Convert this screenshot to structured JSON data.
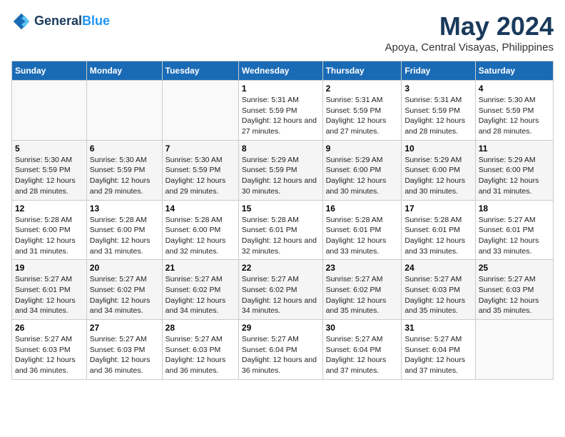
{
  "logo": {
    "line1": "General",
    "line2": "Blue"
  },
  "title": "May 2024",
  "subtitle": "Apoya, Central Visayas, Philippines",
  "days_of_week": [
    "Sunday",
    "Monday",
    "Tuesday",
    "Wednesday",
    "Thursday",
    "Friday",
    "Saturday"
  ],
  "weeks": [
    [
      {
        "day": "",
        "info": ""
      },
      {
        "day": "",
        "info": ""
      },
      {
        "day": "",
        "info": ""
      },
      {
        "day": "1",
        "info": "Sunrise: 5:31 AM\nSunset: 5:59 PM\nDaylight: 12 hours and 27 minutes."
      },
      {
        "day": "2",
        "info": "Sunrise: 5:31 AM\nSunset: 5:59 PM\nDaylight: 12 hours and 27 minutes."
      },
      {
        "day": "3",
        "info": "Sunrise: 5:31 AM\nSunset: 5:59 PM\nDaylight: 12 hours and 28 minutes."
      },
      {
        "day": "4",
        "info": "Sunrise: 5:30 AM\nSunset: 5:59 PM\nDaylight: 12 hours and 28 minutes."
      }
    ],
    [
      {
        "day": "5",
        "info": "Sunrise: 5:30 AM\nSunset: 5:59 PM\nDaylight: 12 hours and 28 minutes."
      },
      {
        "day": "6",
        "info": "Sunrise: 5:30 AM\nSunset: 5:59 PM\nDaylight: 12 hours and 29 minutes."
      },
      {
        "day": "7",
        "info": "Sunrise: 5:30 AM\nSunset: 5:59 PM\nDaylight: 12 hours and 29 minutes."
      },
      {
        "day": "8",
        "info": "Sunrise: 5:29 AM\nSunset: 5:59 PM\nDaylight: 12 hours and 30 minutes."
      },
      {
        "day": "9",
        "info": "Sunrise: 5:29 AM\nSunset: 6:00 PM\nDaylight: 12 hours and 30 minutes."
      },
      {
        "day": "10",
        "info": "Sunrise: 5:29 AM\nSunset: 6:00 PM\nDaylight: 12 hours and 30 minutes."
      },
      {
        "day": "11",
        "info": "Sunrise: 5:29 AM\nSunset: 6:00 PM\nDaylight: 12 hours and 31 minutes."
      }
    ],
    [
      {
        "day": "12",
        "info": "Sunrise: 5:28 AM\nSunset: 6:00 PM\nDaylight: 12 hours and 31 minutes."
      },
      {
        "day": "13",
        "info": "Sunrise: 5:28 AM\nSunset: 6:00 PM\nDaylight: 12 hours and 31 minutes."
      },
      {
        "day": "14",
        "info": "Sunrise: 5:28 AM\nSunset: 6:00 PM\nDaylight: 12 hours and 32 minutes."
      },
      {
        "day": "15",
        "info": "Sunrise: 5:28 AM\nSunset: 6:01 PM\nDaylight: 12 hours and 32 minutes."
      },
      {
        "day": "16",
        "info": "Sunrise: 5:28 AM\nSunset: 6:01 PM\nDaylight: 12 hours and 33 minutes."
      },
      {
        "day": "17",
        "info": "Sunrise: 5:28 AM\nSunset: 6:01 PM\nDaylight: 12 hours and 33 minutes."
      },
      {
        "day": "18",
        "info": "Sunrise: 5:27 AM\nSunset: 6:01 PM\nDaylight: 12 hours and 33 minutes."
      }
    ],
    [
      {
        "day": "19",
        "info": "Sunrise: 5:27 AM\nSunset: 6:01 PM\nDaylight: 12 hours and 34 minutes."
      },
      {
        "day": "20",
        "info": "Sunrise: 5:27 AM\nSunset: 6:02 PM\nDaylight: 12 hours and 34 minutes."
      },
      {
        "day": "21",
        "info": "Sunrise: 5:27 AM\nSunset: 6:02 PM\nDaylight: 12 hours and 34 minutes."
      },
      {
        "day": "22",
        "info": "Sunrise: 5:27 AM\nSunset: 6:02 PM\nDaylight: 12 hours and 34 minutes."
      },
      {
        "day": "23",
        "info": "Sunrise: 5:27 AM\nSunset: 6:02 PM\nDaylight: 12 hours and 35 minutes."
      },
      {
        "day": "24",
        "info": "Sunrise: 5:27 AM\nSunset: 6:03 PM\nDaylight: 12 hours and 35 minutes."
      },
      {
        "day": "25",
        "info": "Sunrise: 5:27 AM\nSunset: 6:03 PM\nDaylight: 12 hours and 35 minutes."
      }
    ],
    [
      {
        "day": "26",
        "info": "Sunrise: 5:27 AM\nSunset: 6:03 PM\nDaylight: 12 hours and 36 minutes."
      },
      {
        "day": "27",
        "info": "Sunrise: 5:27 AM\nSunset: 6:03 PM\nDaylight: 12 hours and 36 minutes."
      },
      {
        "day": "28",
        "info": "Sunrise: 5:27 AM\nSunset: 6:03 PM\nDaylight: 12 hours and 36 minutes."
      },
      {
        "day": "29",
        "info": "Sunrise: 5:27 AM\nSunset: 6:04 PM\nDaylight: 12 hours and 36 minutes."
      },
      {
        "day": "30",
        "info": "Sunrise: 5:27 AM\nSunset: 6:04 PM\nDaylight: 12 hours and 37 minutes."
      },
      {
        "day": "31",
        "info": "Sunrise: 5:27 AM\nSunset: 6:04 PM\nDaylight: 12 hours and 37 minutes."
      },
      {
        "day": "",
        "info": ""
      }
    ]
  ]
}
